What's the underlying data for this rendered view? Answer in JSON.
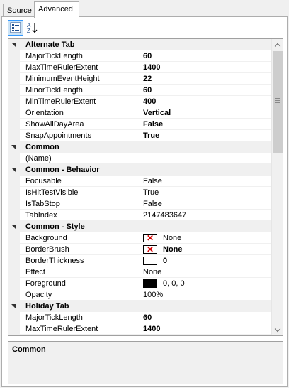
{
  "tabs": [
    {
      "label": "Source",
      "active": false
    },
    {
      "label": "Advanced",
      "active": true
    }
  ],
  "toolbar": {
    "categorized_icon": "categorized-icon",
    "alphabetical_icon": "sort-alphabetical-icon"
  },
  "grid": {
    "categories": [
      {
        "name": "Alternate Tab",
        "properties": [
          {
            "name": "MajorTickLength",
            "value": "60",
            "bold": true
          },
          {
            "name": "MaxTimeRulerExtent",
            "value": "1400",
            "bold": true
          },
          {
            "name": "MinimumEventHeight",
            "value": "22",
            "bold": true
          },
          {
            "name": "MinorTickLength",
            "value": "60",
            "bold": true
          },
          {
            "name": "MinTimeRulerExtent",
            "value": "400",
            "bold": true
          },
          {
            "name": "Orientation",
            "value": "Vertical",
            "bold": true
          },
          {
            "name": "ShowAllDayArea",
            "value": "False",
            "bold": true
          },
          {
            "name": "SnapAppointments",
            "value": "True",
            "bold": true
          }
        ]
      },
      {
        "name": "Common",
        "properties": [
          {
            "name": "(Name)",
            "value": "",
            "bold": false
          }
        ]
      },
      {
        "name": "Common - Behavior",
        "properties": [
          {
            "name": "Focusable",
            "value": "False",
            "bold": false
          },
          {
            "name": "IsHitTestVisible",
            "value": "True",
            "bold": false
          },
          {
            "name": "IsTabStop",
            "value": "False",
            "bold": false
          },
          {
            "name": "TabIndex",
            "value": "2147483647",
            "bold": false
          }
        ]
      },
      {
        "name": "Common - Style",
        "properties": [
          {
            "name": "Background",
            "value": "None",
            "bold": false,
            "swatch": "none"
          },
          {
            "name": "BorderBrush",
            "value": "None",
            "bold": true,
            "swatch": "none"
          },
          {
            "name": "BorderThickness",
            "value": "0",
            "bold": true,
            "swatch": "empty"
          },
          {
            "name": "Effect",
            "value": "None",
            "bold": false
          },
          {
            "name": "Foreground",
            "value": "0, 0, 0",
            "bold": false,
            "swatch": "black"
          },
          {
            "name": "Opacity",
            "value": "100%",
            "bold": false
          }
        ]
      },
      {
        "name": "Holiday Tab",
        "properties": [
          {
            "name": "MajorTickLength",
            "value": "60",
            "bold": true
          },
          {
            "name": "MaxTimeRulerExtent",
            "value": "1400",
            "bold": true
          }
        ]
      }
    ]
  },
  "description": {
    "title": "Common"
  },
  "colors": {
    "category_bg": "#f0f0f0",
    "swatch_x": "#d40000",
    "selected_tool_bg": "#cce4f7",
    "selected_tool_border": "#3399ff"
  }
}
